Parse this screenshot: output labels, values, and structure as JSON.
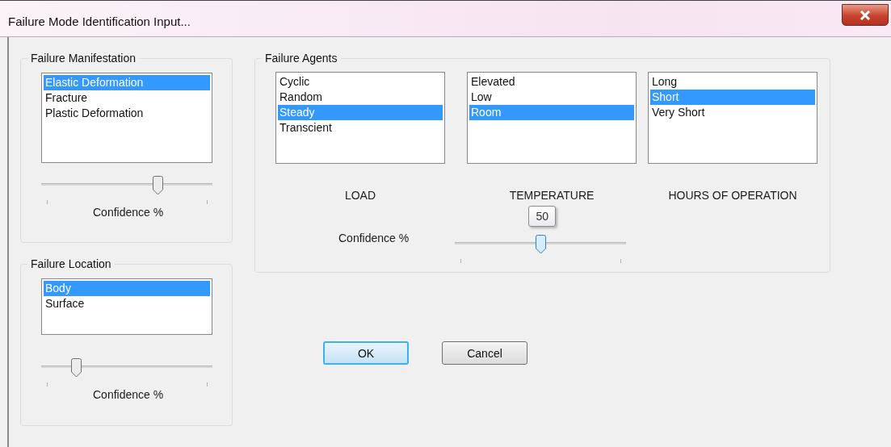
{
  "window": {
    "title": "Failure Mode Identification Input..."
  },
  "manifestation": {
    "title": "Failure Manifestation",
    "items": [
      {
        "label": "Elastic Deformation",
        "selected": true
      },
      {
        "label": "Fracture",
        "selected": false
      },
      {
        "label": "Plastic Deformation",
        "selected": false
      }
    ],
    "slider": {
      "level": 0.69
    },
    "caption": "Confidence %"
  },
  "location": {
    "title": "Failure Location",
    "items": [
      {
        "label": "Body",
        "selected": true
      },
      {
        "label": "Surface",
        "selected": false
      }
    ],
    "slider": {
      "level": 0.18
    },
    "caption": "Confidence %"
  },
  "agents": {
    "title": "Failure Agents",
    "lists": [
      {
        "caption": "LOAD",
        "items": [
          {
            "label": "Cyclic",
            "selected": false
          },
          {
            "label": "Random",
            "selected": false
          },
          {
            "label": "Steady",
            "selected": true
          },
          {
            "label": "Transcient",
            "selected": false
          }
        ]
      },
      {
        "caption": "TEMPERATURE",
        "items": [
          {
            "label": "Elevated",
            "selected": false
          },
          {
            "label": "Low",
            "selected": false
          },
          {
            "label": "Room",
            "selected": true
          }
        ]
      },
      {
        "caption": "HOURS OF OPERATION",
        "items": [
          {
            "label": "Long",
            "selected": false
          },
          {
            "label": "Short",
            "selected": true
          },
          {
            "label": "Very Short",
            "selected": false
          }
        ]
      }
    ],
    "confidence": {
      "label": "Confidence %",
      "slider": {
        "level": 0.5,
        "tooltip": "50"
      }
    }
  },
  "buttons": [
    {
      "label": "OK",
      "default": true
    },
    {
      "label": "Cancel",
      "default": false
    }
  ]
}
